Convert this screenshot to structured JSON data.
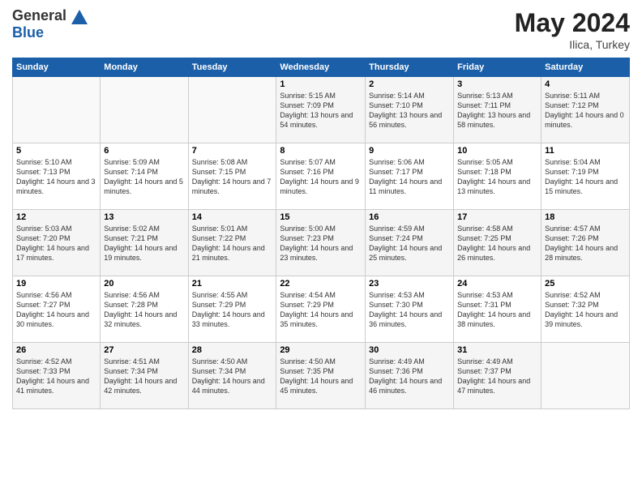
{
  "header": {
    "logo_line1": "General",
    "logo_line2": "Blue",
    "title": "May 2024",
    "location": "Ilica, Turkey"
  },
  "weekdays": [
    "Sunday",
    "Monday",
    "Tuesday",
    "Wednesday",
    "Thursday",
    "Friday",
    "Saturday"
  ],
  "weeks": [
    [
      {
        "day": "",
        "sunrise": "",
        "sunset": "",
        "daylight": ""
      },
      {
        "day": "",
        "sunrise": "",
        "sunset": "",
        "daylight": ""
      },
      {
        "day": "",
        "sunrise": "",
        "sunset": "",
        "daylight": ""
      },
      {
        "day": "1",
        "sunrise": "Sunrise: 5:15 AM",
        "sunset": "Sunset: 7:09 PM",
        "daylight": "Daylight: 13 hours and 54 minutes."
      },
      {
        "day": "2",
        "sunrise": "Sunrise: 5:14 AM",
        "sunset": "Sunset: 7:10 PM",
        "daylight": "Daylight: 13 hours and 56 minutes."
      },
      {
        "day": "3",
        "sunrise": "Sunrise: 5:13 AM",
        "sunset": "Sunset: 7:11 PM",
        "daylight": "Daylight: 13 hours and 58 minutes."
      },
      {
        "day": "4",
        "sunrise": "Sunrise: 5:11 AM",
        "sunset": "Sunset: 7:12 PM",
        "daylight": "Daylight: 14 hours and 0 minutes."
      }
    ],
    [
      {
        "day": "5",
        "sunrise": "Sunrise: 5:10 AM",
        "sunset": "Sunset: 7:13 PM",
        "daylight": "Daylight: 14 hours and 3 minutes."
      },
      {
        "day": "6",
        "sunrise": "Sunrise: 5:09 AM",
        "sunset": "Sunset: 7:14 PM",
        "daylight": "Daylight: 14 hours and 5 minutes."
      },
      {
        "day": "7",
        "sunrise": "Sunrise: 5:08 AM",
        "sunset": "Sunset: 7:15 PM",
        "daylight": "Daylight: 14 hours and 7 minutes."
      },
      {
        "day": "8",
        "sunrise": "Sunrise: 5:07 AM",
        "sunset": "Sunset: 7:16 PM",
        "daylight": "Daylight: 14 hours and 9 minutes."
      },
      {
        "day": "9",
        "sunrise": "Sunrise: 5:06 AM",
        "sunset": "Sunset: 7:17 PM",
        "daylight": "Daylight: 14 hours and 11 minutes."
      },
      {
        "day": "10",
        "sunrise": "Sunrise: 5:05 AM",
        "sunset": "Sunset: 7:18 PM",
        "daylight": "Daylight: 14 hours and 13 minutes."
      },
      {
        "day": "11",
        "sunrise": "Sunrise: 5:04 AM",
        "sunset": "Sunset: 7:19 PM",
        "daylight": "Daylight: 14 hours and 15 minutes."
      }
    ],
    [
      {
        "day": "12",
        "sunrise": "Sunrise: 5:03 AM",
        "sunset": "Sunset: 7:20 PM",
        "daylight": "Daylight: 14 hours and 17 minutes."
      },
      {
        "day": "13",
        "sunrise": "Sunrise: 5:02 AM",
        "sunset": "Sunset: 7:21 PM",
        "daylight": "Daylight: 14 hours and 19 minutes."
      },
      {
        "day": "14",
        "sunrise": "Sunrise: 5:01 AM",
        "sunset": "Sunset: 7:22 PM",
        "daylight": "Daylight: 14 hours and 21 minutes."
      },
      {
        "day": "15",
        "sunrise": "Sunrise: 5:00 AM",
        "sunset": "Sunset: 7:23 PM",
        "daylight": "Daylight: 14 hours and 23 minutes."
      },
      {
        "day": "16",
        "sunrise": "Sunrise: 4:59 AM",
        "sunset": "Sunset: 7:24 PM",
        "daylight": "Daylight: 14 hours and 25 minutes."
      },
      {
        "day": "17",
        "sunrise": "Sunrise: 4:58 AM",
        "sunset": "Sunset: 7:25 PM",
        "daylight": "Daylight: 14 hours and 26 minutes."
      },
      {
        "day": "18",
        "sunrise": "Sunrise: 4:57 AM",
        "sunset": "Sunset: 7:26 PM",
        "daylight": "Daylight: 14 hours and 28 minutes."
      }
    ],
    [
      {
        "day": "19",
        "sunrise": "Sunrise: 4:56 AM",
        "sunset": "Sunset: 7:27 PM",
        "daylight": "Daylight: 14 hours and 30 minutes."
      },
      {
        "day": "20",
        "sunrise": "Sunrise: 4:56 AM",
        "sunset": "Sunset: 7:28 PM",
        "daylight": "Daylight: 14 hours and 32 minutes."
      },
      {
        "day": "21",
        "sunrise": "Sunrise: 4:55 AM",
        "sunset": "Sunset: 7:29 PM",
        "daylight": "Daylight: 14 hours and 33 minutes."
      },
      {
        "day": "22",
        "sunrise": "Sunrise: 4:54 AM",
        "sunset": "Sunset: 7:29 PM",
        "daylight": "Daylight: 14 hours and 35 minutes."
      },
      {
        "day": "23",
        "sunrise": "Sunrise: 4:53 AM",
        "sunset": "Sunset: 7:30 PM",
        "daylight": "Daylight: 14 hours and 36 minutes."
      },
      {
        "day": "24",
        "sunrise": "Sunrise: 4:53 AM",
        "sunset": "Sunset: 7:31 PM",
        "daylight": "Daylight: 14 hours and 38 minutes."
      },
      {
        "day": "25",
        "sunrise": "Sunrise: 4:52 AM",
        "sunset": "Sunset: 7:32 PM",
        "daylight": "Daylight: 14 hours and 39 minutes."
      }
    ],
    [
      {
        "day": "26",
        "sunrise": "Sunrise: 4:52 AM",
        "sunset": "Sunset: 7:33 PM",
        "daylight": "Daylight: 14 hours and 41 minutes."
      },
      {
        "day": "27",
        "sunrise": "Sunrise: 4:51 AM",
        "sunset": "Sunset: 7:34 PM",
        "daylight": "Daylight: 14 hours and 42 minutes."
      },
      {
        "day": "28",
        "sunrise": "Sunrise: 4:50 AM",
        "sunset": "Sunset: 7:34 PM",
        "daylight": "Daylight: 14 hours and 44 minutes."
      },
      {
        "day": "29",
        "sunrise": "Sunrise: 4:50 AM",
        "sunset": "Sunset: 7:35 PM",
        "daylight": "Daylight: 14 hours and 45 minutes."
      },
      {
        "day": "30",
        "sunrise": "Sunrise: 4:49 AM",
        "sunset": "Sunset: 7:36 PM",
        "daylight": "Daylight: 14 hours and 46 minutes."
      },
      {
        "day": "31",
        "sunrise": "Sunrise: 4:49 AM",
        "sunset": "Sunset: 7:37 PM",
        "daylight": "Daylight: 14 hours and 47 minutes."
      },
      {
        "day": "",
        "sunrise": "",
        "sunset": "",
        "daylight": ""
      }
    ]
  ]
}
